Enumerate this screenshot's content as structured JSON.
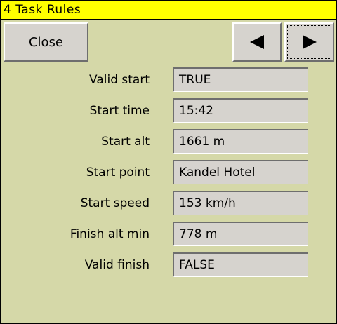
{
  "title": "4 Task Rules",
  "buttons": {
    "close_label": "Close",
    "prev_icon": "arrow-left-icon",
    "next_icon": "arrow-right-icon"
  },
  "rules": [
    {
      "label": "Valid start",
      "value": "TRUE"
    },
    {
      "label": "Start time",
      "value": "15:42"
    },
    {
      "label": "Start alt",
      "value": "1661 m"
    },
    {
      "label": "Start point",
      "value": "Kandel Hotel"
    },
    {
      "label": "Start speed",
      "value": "153 km/h"
    },
    {
      "label": "Finish alt min",
      "value": "778 m"
    },
    {
      "label": "Valid finish",
      "value": "FALSE"
    }
  ],
  "colors": {
    "title_bar": "#ffff00",
    "background": "#d5d8a8",
    "control": "#d6d3ce"
  }
}
